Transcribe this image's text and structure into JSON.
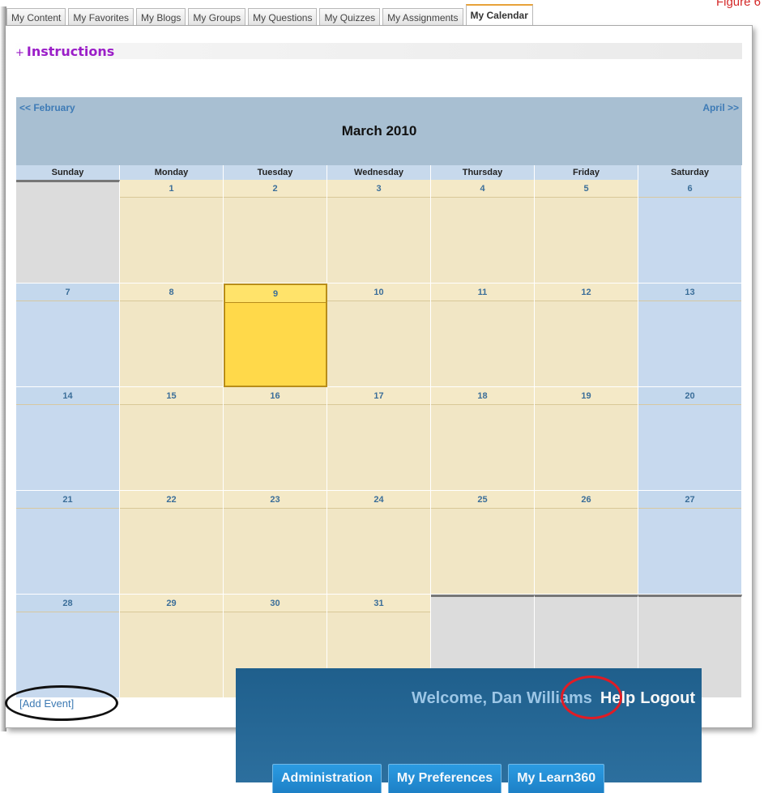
{
  "figure_label": "Figure 6",
  "tabs": [
    "My Content",
    "My Favorites",
    "My Blogs",
    "My Groups",
    "My Questions",
    "My Quizzes",
    "My Assignments",
    "My Calendar"
  ],
  "active_tab": "My Calendar",
  "instructions": {
    "icon": "+",
    "label": "Instructions"
  },
  "calendar": {
    "prev_label": "<< February",
    "next_label": "April >>",
    "title": "March  2010",
    "day_headers": [
      "Sunday",
      "Monday",
      "Tuesday",
      "Wednesday",
      "Thursday",
      "Friday",
      "Saturday"
    ],
    "today": "9",
    "weeks": [
      [
        "",
        "1",
        "2",
        "3",
        "4",
        "5",
        "6"
      ],
      [
        "7",
        "8",
        "9",
        "10",
        "11",
        "12",
        "13"
      ],
      [
        "14",
        "15",
        "16",
        "17",
        "18",
        "19",
        "20"
      ],
      [
        "21",
        "22",
        "23",
        "24",
        "25",
        "26",
        "27"
      ],
      [
        "28",
        "29",
        "30",
        "31",
        "",
        "",
        ""
      ]
    ]
  },
  "add_event": "[Add Event]",
  "welcome_panel": {
    "welcome": "Welcome, Dan Williams",
    "help": "Help",
    "logout": "Logout",
    "buttons": [
      "Administration",
      "My Preferences",
      "My Learn360"
    ]
  }
}
